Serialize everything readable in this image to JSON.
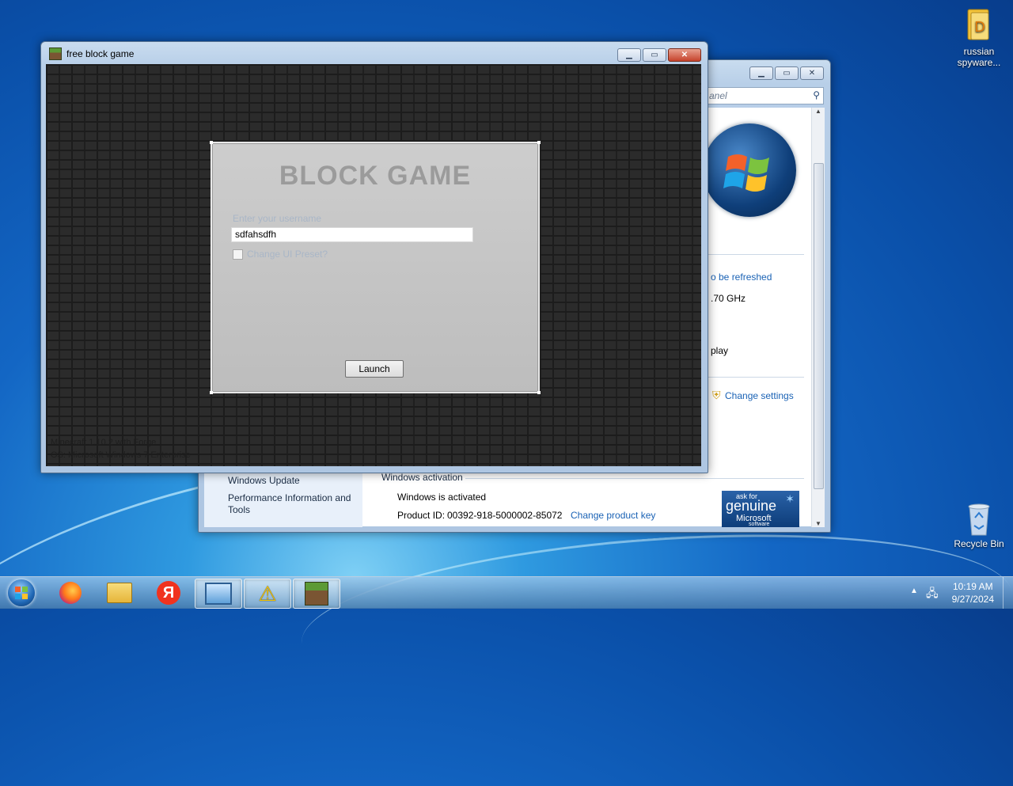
{
  "desktop": {
    "icons": [
      {
        "label": "russian spyware...",
        "icon": "folder-icon"
      },
      {
        "label": "Recycle Bin",
        "icon": "recycle-bin-icon"
      }
    ]
  },
  "game_window": {
    "title": "free block game",
    "login": {
      "heading": "BLOCK GAME",
      "username_label": "Enter your username",
      "username_value": "sdfahsdfh",
      "checkbox_label": "Change UI Preset?",
      "launch_label": "Launch"
    },
    "version_line1": "Minecraft 1.10.2 with Forge",
    "version_line2": "OS: Microsoft Windows 7 Enterprise"
  },
  "control_panel": {
    "search_placeholder": "anel",
    "refresh_text": "o be refreshed",
    "cpu_text": ".70 GHz",
    "display_text": "play",
    "change_settings": "Change settings",
    "see_also": [
      "Windows Update",
      "Performance Information and Tools"
    ],
    "activation_heading": "Windows activation",
    "activation_status": "Windows is activated",
    "product_id_label": "Product ID:",
    "product_id_value": "00392-918-5000002-85072",
    "change_key": "Change product key",
    "genuine_small": "ask for",
    "genuine_big": "genuine",
    "genuine_brand": "Microsoft",
    "genuine_sub": "software"
  },
  "taskbar": {
    "apps": [
      "start-orb",
      "firefox",
      "explorer",
      "yandex",
      "control-panel",
      "warning",
      "minecraft"
    ],
    "time": "10:19 AM",
    "date": "9/27/2024"
  }
}
